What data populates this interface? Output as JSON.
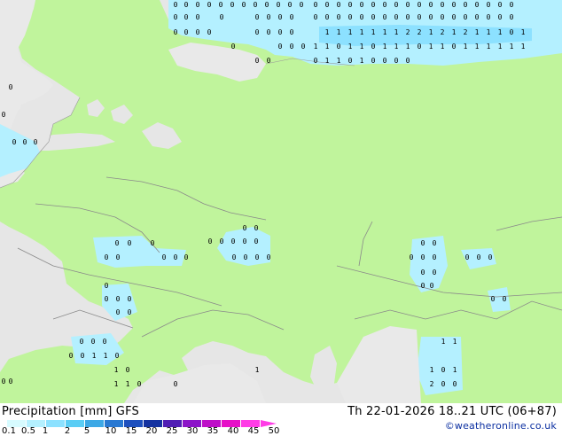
{
  "footer": {
    "title_left": "Precipitation [mm]  GFS",
    "title_right": "Th 22-01-2026 18..21 UTC (06+87)",
    "credit": "©weatheronline.co.uk"
  },
  "legend": {
    "ticks": [
      "0.1",
      "0.5",
      "1",
      "2",
      "5",
      "10",
      "15",
      "20",
      "25",
      "30",
      "35",
      "40",
      "45",
      "50"
    ],
    "colors": [
      "#d7fbff",
      "#b4f0ff",
      "#8ce1ff",
      "#5acdf5",
      "#3ca8e6",
      "#2878d2",
      "#1e50be",
      "#1432a0",
      "#501eb4",
      "#8c14c8",
      "#be0fc8",
      "#e60fc8",
      "#ff3ce6"
    ]
  },
  "map": {
    "colors": {
      "sea": "#e6e6e6",
      "land_precip": "#c0f49c",
      "land_dry": "#e9e9e9",
      "light_rain": "#b4f0ff",
      "medium_rain": "#8ce1ff",
      "border": "#8a8a8a"
    },
    "markers": [
      {
        "r": 0,
        "labels": [
          "0",
          "0",
          "0",
          "0",
          "0",
          "0",
          "0",
          "0",
          "0",
          "0",
          "0",
          "0",
          "0",
          "0",
          "0",
          "0",
          "0",
          "0",
          "0",
          "0",
          "0",
          "0",
          "0",
          "0",
          "0",
          "0",
          "0",
          "0",
          "0",
          "0"
        ]
      },
      {
        "r": 1,
        "labels": [
          "0",
          "0",
          "0",
          "0",
          "0",
          "0",
          "0",
          "0",
          "0",
          "0",
          "0",
          "0",
          "0",
          "0",
          "0",
          "0",
          "0",
          "0",
          "0",
          "0",
          "0",
          "0",
          "0",
          "0",
          "0",
          "0"
        ]
      },
      {
        "r": 2,
        "labels": [
          "0",
          "0",
          "0",
          "0",
          "0",
          "0",
          "0",
          "0",
          "1",
          "1",
          "1",
          "1",
          "1",
          "1",
          "1",
          "2",
          "2",
          "1",
          "2",
          "1",
          "2",
          "1",
          "1",
          "1",
          "0",
          "1"
        ]
      },
      {
        "r": 3,
        "labels": [
          "0",
          "0",
          "0",
          "0",
          "1",
          "1",
          "0",
          "1",
          "1",
          "0",
          "1",
          "1",
          "1",
          "0",
          "1",
          "1",
          "0",
          "1",
          "1",
          "1",
          "1",
          "1",
          "1"
        ]
      },
      {
        "r": 4,
        "labels": [
          "0",
          "0",
          "0",
          "1",
          "1",
          "0",
          "1",
          "0",
          "0",
          "0",
          "0"
        ]
      },
      {
        "r": 5,
        "labels": [
          "0",
          "0",
          "0",
          "0",
          "0",
          "0",
          "0",
          "0",
          "0",
          "0",
          "0",
          "0",
          "0",
          "0",
          "0",
          "0",
          "0",
          "0",
          "0",
          "0",
          "0",
          "0",
          "0",
          "0",
          "0",
          "0",
          "0",
          "0",
          "0",
          "0",
          "0",
          "0",
          "0",
          "0",
          "0",
          "0",
          "0",
          "0",
          "0",
          "0",
          "0",
          "0",
          "0",
          "0",
          "0",
          "0",
          "0",
          "0",
          "0",
          "0",
          "0",
          "1",
          "1",
          "0",
          "1",
          "0",
          "1",
          "1",
          "0",
          "0",
          "1",
          "1",
          "1",
          "1",
          "0",
          "1",
          "2",
          "0",
          "0",
          "0"
        ]
      }
    ]
  }
}
